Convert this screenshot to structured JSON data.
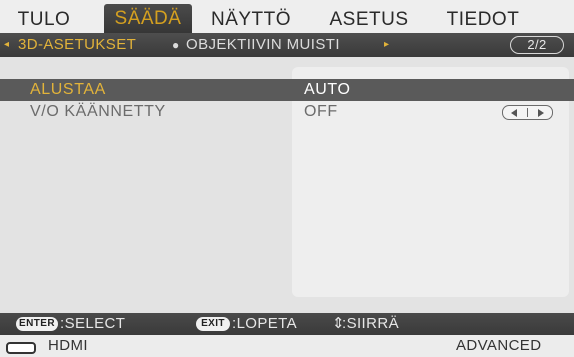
{
  "tabs": [
    {
      "label": "TULO",
      "active": false
    },
    {
      "label": "SÄÄDÄ",
      "active": true
    },
    {
      "label": "NÄYTTÖ",
      "active": false
    },
    {
      "label": "ASETUS",
      "active": false
    },
    {
      "label": "TIEDOT",
      "active": false
    }
  ],
  "submenu": {
    "left_arrow": "◂",
    "current": "3D-ASETUKSET",
    "separator": "●",
    "next": "OBJEKTIIVIN MUISTI",
    "right_arrow": "▸",
    "page": "2/2"
  },
  "rows": [
    {
      "label": "ALUSTAA",
      "value": "AUTO",
      "selected": true
    },
    {
      "label": "V/O KÄÄNNETTY",
      "value": "OFF",
      "selected": false
    }
  ],
  "help": {
    "enter_key": "ENTER",
    "enter_text": ":SELECT",
    "exit_key": "EXIT",
    "exit_text": ":LOPETA",
    "move_text": ":SIIRRÄ",
    "move_icon": "up-down-arrows"
  },
  "status": {
    "source": "HDMI",
    "mode": "ADVANCED"
  },
  "colors": {
    "accent": "#e2b33a",
    "bar_dark": "#3f3f3f",
    "selected_row": "#5a5a5a"
  }
}
